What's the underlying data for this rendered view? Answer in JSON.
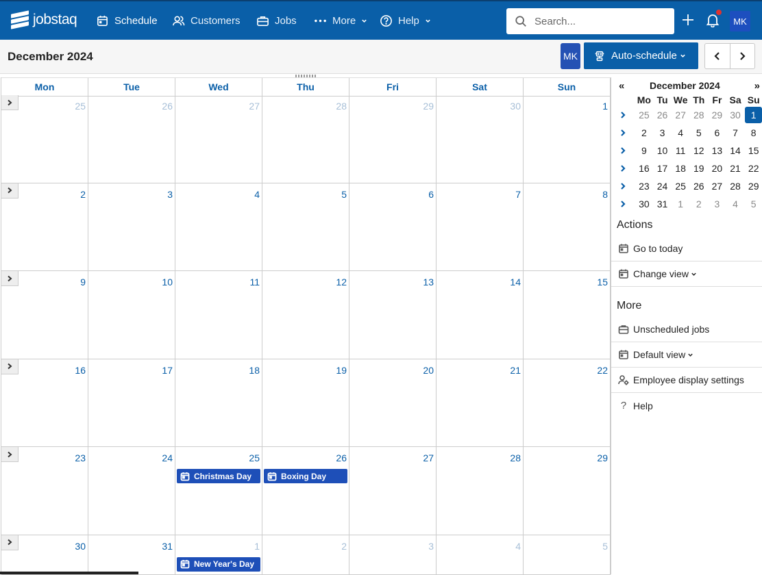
{
  "app": {
    "brand": "jobstaq"
  },
  "nav": {
    "schedule": "Schedule",
    "customers": "Customers",
    "jobs": "Jobs",
    "more": "More",
    "help": "Help"
  },
  "search": {
    "placeholder": "Search..."
  },
  "user": {
    "initials": "MK"
  },
  "header": {
    "title": "December 2024",
    "auto_schedule": "Auto-schedule",
    "employee_initials": "MK"
  },
  "calendar": {
    "weekdays": [
      "Mon",
      "Tue",
      "Wed",
      "Thu",
      "Fri",
      "Sat",
      "Sun"
    ],
    "weeks": [
      {
        "days": [
          {
            "n": "25",
            "other": true
          },
          {
            "n": "26",
            "other": true
          },
          {
            "n": "27",
            "other": true
          },
          {
            "n": "28",
            "other": true
          },
          {
            "n": "29",
            "other": true
          },
          {
            "n": "30",
            "other": true
          },
          {
            "n": "1"
          }
        ]
      },
      {
        "days": [
          {
            "n": "2"
          },
          {
            "n": "3"
          },
          {
            "n": "4"
          },
          {
            "n": "5"
          },
          {
            "n": "6"
          },
          {
            "n": "7"
          },
          {
            "n": "8"
          }
        ]
      },
      {
        "days": [
          {
            "n": "9"
          },
          {
            "n": "10"
          },
          {
            "n": "11"
          },
          {
            "n": "12"
          },
          {
            "n": "13"
          },
          {
            "n": "14"
          },
          {
            "n": "15"
          }
        ]
      },
      {
        "days": [
          {
            "n": "16"
          },
          {
            "n": "17"
          },
          {
            "n": "18"
          },
          {
            "n": "19"
          },
          {
            "n": "20"
          },
          {
            "n": "21"
          },
          {
            "n": "22"
          }
        ]
      },
      {
        "days": [
          {
            "n": "23"
          },
          {
            "n": "24"
          },
          {
            "n": "25",
            "event": "Christmas Day"
          },
          {
            "n": "26",
            "event": "Boxing Day"
          },
          {
            "n": "27"
          },
          {
            "n": "28"
          },
          {
            "n": "29"
          }
        ]
      },
      {
        "days": [
          {
            "n": "30"
          },
          {
            "n": "31"
          },
          {
            "n": "1",
            "other": true,
            "event": "New Year's Day"
          },
          {
            "n": "2",
            "other": true
          },
          {
            "n": "3",
            "other": true
          },
          {
            "n": "4",
            "other": true
          },
          {
            "n": "5",
            "other": true
          }
        ]
      }
    ]
  },
  "mini_calendar": {
    "prev": "«",
    "next": "»",
    "title": "December 2024",
    "weekdays": [
      "Mo",
      "Tu",
      "We",
      "Th",
      "Fr",
      "Sa",
      "Su"
    ],
    "weeks": [
      [
        "25",
        "26",
        "27",
        "28",
        "29",
        "30",
        "1"
      ],
      [
        "2",
        "3",
        "4",
        "5",
        "6",
        "7",
        "8"
      ],
      [
        "9",
        "10",
        "11",
        "12",
        "13",
        "14",
        "15"
      ],
      [
        "16",
        "17",
        "18",
        "19",
        "20",
        "21",
        "22"
      ],
      [
        "23",
        "24",
        "25",
        "26",
        "27",
        "28",
        "29"
      ],
      [
        "30",
        "31",
        "1",
        "2",
        "3",
        "4",
        "5"
      ]
    ],
    "today": "1"
  },
  "actions": {
    "title": "Actions",
    "go_to_today": "Go to today",
    "change_view": "Change view"
  },
  "more": {
    "title": "More",
    "unscheduled_jobs": "Unscheduled jobs",
    "default_view": "Default view",
    "employee_display_settings": "Employee display settings",
    "help": "Help"
  }
}
